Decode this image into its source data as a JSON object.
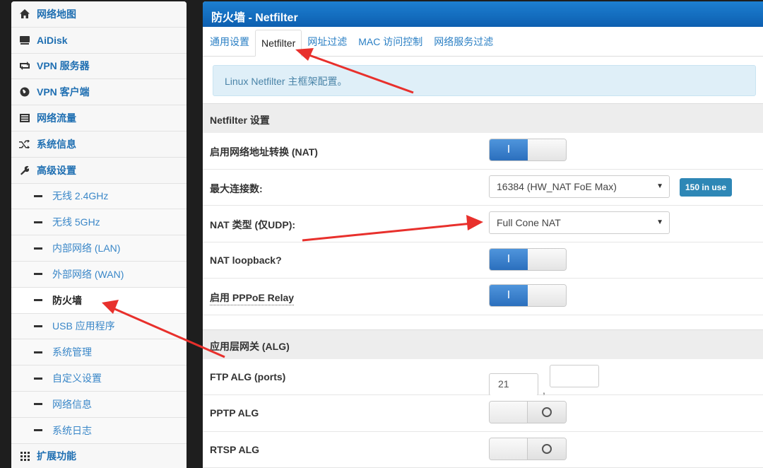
{
  "sidebar": {
    "items": [
      {
        "label": "网络地图",
        "icon": "home-icon"
      },
      {
        "label": "AiDisk",
        "icon": "drive-icon"
      },
      {
        "label": "VPN 服务器",
        "icon": "retweet-icon"
      },
      {
        "label": "VPN 客户端",
        "icon": "globe-icon"
      },
      {
        "label": "网络流量",
        "icon": "list-icon"
      },
      {
        "label": "系统信息",
        "icon": "random-icon"
      },
      {
        "label": "高级设置",
        "icon": "wrench-icon"
      }
    ],
    "sub_items": [
      {
        "label": "无线 2.4GHz"
      },
      {
        "label": "无线 5GHz"
      },
      {
        "label": "内部网络 (LAN)"
      },
      {
        "label": "外部网络 (WAN)"
      },
      {
        "label": "防火墙",
        "active": true
      },
      {
        "label": "USB 应用程序"
      },
      {
        "label": "系统管理"
      },
      {
        "label": "自定义设置"
      },
      {
        "label": "网络信息"
      },
      {
        "label": "系统日志"
      }
    ],
    "extra": {
      "label": "扩展功能",
      "icon": "grid-icon"
    }
  },
  "header": {
    "title": "防火墙 - Netfilter"
  },
  "tabs": [
    {
      "label": "通用设置"
    },
    {
      "label": "Netfilter",
      "active": true
    },
    {
      "label": "网址过滤"
    },
    {
      "label": "MAC 访问控制"
    },
    {
      "label": "网络服务过滤"
    }
  ],
  "info": "Linux Netfilter 主框架配置。",
  "netfilter": {
    "heading": "Netfilter 设置",
    "nat_label": "启用网络地址转换 (NAT)",
    "nat_toggle": "I",
    "maxconn_label": "最大连接数:",
    "maxconn_value": "16384 (HW_NAT FoE Max)",
    "in_use_badge": "150 in use",
    "nattype_label": "NAT 类型 (仅UDP):",
    "nattype_value": "Full Cone NAT",
    "loopback_label": "NAT loopback?",
    "loopback_toggle": "I",
    "pppoe_label": "启用 PPPoE Relay",
    "pppoe_toggle": "I"
  },
  "alg": {
    "heading": "应用层网关 (ALG)",
    "ftp_label": "FTP ALG (ports)",
    "ftp_port1": "21",
    "ftp_sep": ",",
    "ftp_port2": "",
    "pptp_label": "PPTP ALG",
    "rtsp_label": "RTSP ALG"
  },
  "colors": {
    "header_blue": "#0d5fb0",
    "link_blue": "#2a7fc4",
    "toggle_on": "#2b6fbd",
    "badge": "#2e87b6",
    "annotation_red": "#e8302c"
  }
}
